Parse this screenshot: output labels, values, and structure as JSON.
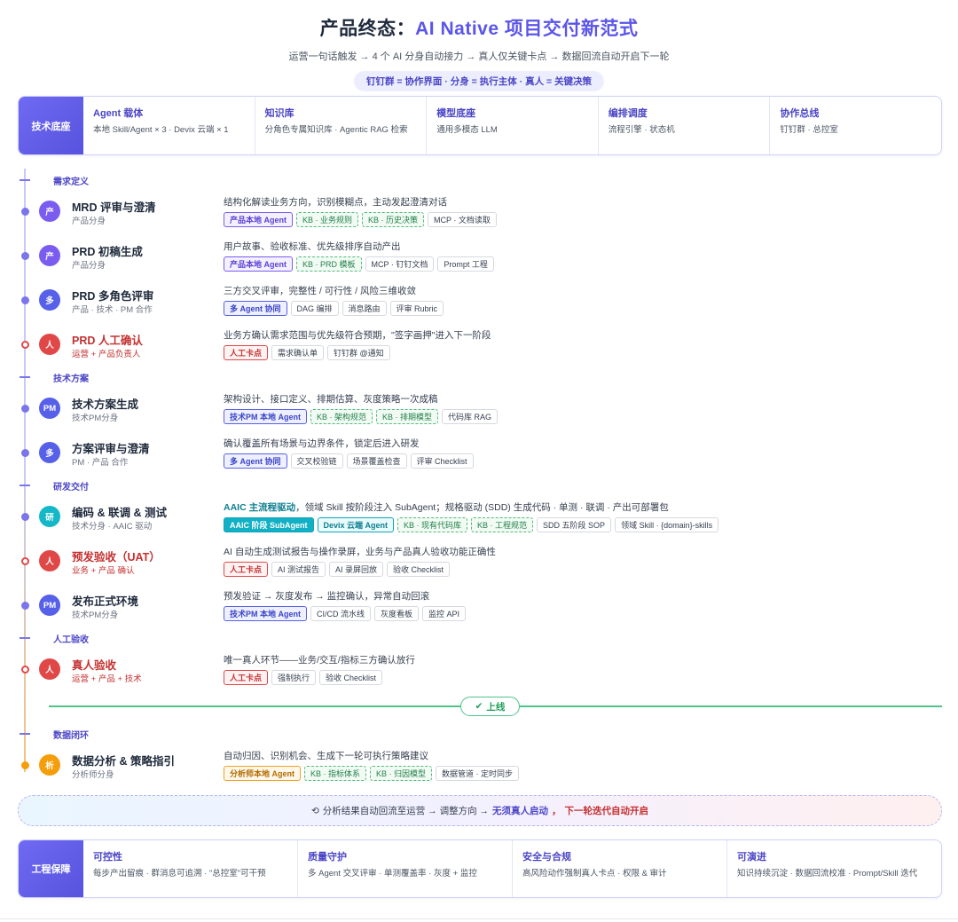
{
  "header": {
    "title_prefix": "产品终态：",
    "title_accent": "AI Native 项目交付新范式",
    "subtitle": "运营一句话触发 → 4 个 AI 分身自动接力 → 真人仅关键卡点 → 数据回流自动开启下一轮",
    "pill": "钉钉群 = 协作界面 · 分身 = 执行主体 · 真人 = 关键决策"
  },
  "tech_base": {
    "label": "技术底座",
    "cells": [
      {
        "title": "Agent 载体",
        "desc": "本地 Skill/Agent × 3 · Devix 云端 × 1"
      },
      {
        "title": "知识库",
        "desc": "分角色专属知识库 · Agentic RAG 检索"
      },
      {
        "title": "模型底座",
        "desc": "通用多模态 LLM"
      },
      {
        "title": "编排调度",
        "desc": "流程引擎 · 状态机"
      },
      {
        "title": "协作总线",
        "desc": "钉钉群 · 总控室"
      }
    ]
  },
  "sections": [
    "需求定义",
    "技术方案",
    "研发交付",
    "人工验收",
    "数据闭环"
  ],
  "steps": [
    {
      "avatar": "产",
      "name": "MRD 评审与澄清",
      "role": "产品分身",
      "desc": "结构化解读业务方向，识别模糊点，主动发起澄清对话",
      "tags": [
        {
          "t": "产品本地 Agent",
          "k": "agent"
        },
        {
          "t": "KB · 业务规则",
          "k": "kb"
        },
        {
          "t": "KB · 历史决策",
          "k": "kb"
        },
        {
          "t": "MCP · 文档读取",
          "k": "plain"
        }
      ]
    },
    {
      "avatar": "产",
      "name": "PRD 初稿生成",
      "role": "产品分身",
      "desc": "用户故事、验收标准、优先级排序自动产出",
      "tags": [
        {
          "t": "产品本地 Agent",
          "k": "agent"
        },
        {
          "t": "KB · PRD 模板",
          "k": "kb"
        },
        {
          "t": "MCP · 钉钉文档",
          "k": "plain"
        },
        {
          "t": "Prompt 工程",
          "k": "plain"
        }
      ]
    },
    {
      "avatar": "多",
      "name": "PRD 多角色评审",
      "role": "产品 · 技术 · PM 合作",
      "desc": "三方交叉评审，完整性 / 可行性 / 风险三维收敛",
      "tags": [
        {
          "t": "多 Agent 协同",
          "k": "multi"
        },
        {
          "t": "DAG 编排",
          "k": "plain"
        },
        {
          "t": "消息路由",
          "k": "plain"
        },
        {
          "t": "评审 Rubric",
          "k": "plain"
        }
      ]
    },
    {
      "avatar": "人",
      "name": "PRD 人工确认",
      "role": "运营 + 产品负责人",
      "desc": "业务方确认需求范围与优先级符合预期，\"签字画押\"进入下一阶段",
      "tags": [
        {
          "t": "人工卡点",
          "k": "human"
        },
        {
          "t": "需求确认单",
          "k": "plain"
        },
        {
          "t": "钉钉群 @通知",
          "k": "plain"
        }
      ]
    },
    {
      "avatar": "PM",
      "name": "技术方案生成",
      "role": "技术PM分身",
      "desc": "架构设计、接口定义、排期估算、灰度策略一次成稿",
      "tags": [
        {
          "t": "技术PM 本地 Agent",
          "k": "multi"
        },
        {
          "t": "KB · 架构规范",
          "k": "kb"
        },
        {
          "t": "KB · 排期模型",
          "k": "kb"
        },
        {
          "t": "代码库 RAG",
          "k": "plain"
        }
      ]
    },
    {
      "avatar": "多",
      "name": "方案评审与澄清",
      "role": "PM · 产品 合作",
      "desc": "确认覆盖所有场景与边界条件，锁定后进入研发",
      "tags": [
        {
          "t": "多 Agent 协同",
          "k": "multi"
        },
        {
          "t": "交叉校验链",
          "k": "plain"
        },
        {
          "t": "场景覆盖检查",
          "k": "plain"
        },
        {
          "t": "评审 Checklist",
          "k": "plain"
        }
      ]
    },
    {
      "avatar": "研",
      "name": "编码 & 联调 & 测试",
      "role": "技术分身 · AAIC 驱动",
      "desc_strong": "AAIC 主流程驱动",
      "desc": "，领域 Skill 按阶段注入 SubAgent；规格驱动 (SDD) 生成代码 · 单测 · 联调 · 产出可部署包",
      "tags": [
        {
          "t": "AAIC 阶段 SubAgent",
          "k": "aaic"
        },
        {
          "t": "Devix 云端 Agent",
          "k": "devix"
        },
        {
          "t": "KB · 现有代码库",
          "k": "kb"
        },
        {
          "t": "KB · 工程规范",
          "k": "kb"
        },
        {
          "t": "SDD 五阶段 SOP",
          "k": "plain"
        },
        {
          "t": "领域 Skill · {domain}-skills",
          "k": "plain"
        }
      ]
    },
    {
      "avatar": "人",
      "name": "预发验收（UAT）",
      "role": "业务 + 产品 确认",
      "desc": "AI 自动生成测试报告与操作录屏，业务与产品真人验收功能正确性",
      "tags": [
        {
          "t": "人工卡点",
          "k": "human"
        },
        {
          "t": "AI 测试报告",
          "k": "plain"
        },
        {
          "t": "AI 录屏回放",
          "k": "plain"
        },
        {
          "t": "验收 Checklist",
          "k": "plain"
        }
      ]
    },
    {
      "avatar": "PM",
      "name": "发布正式环境",
      "role": "技术PM分身",
      "desc": "预发验证 → 灰度发布 → 监控确认，异常自动回滚",
      "tags": [
        {
          "t": "技术PM 本地 Agent",
          "k": "multi"
        },
        {
          "t": "CI/CD 流水线",
          "k": "plain"
        },
        {
          "t": "灰度看板",
          "k": "plain"
        },
        {
          "t": "监控 API",
          "k": "plain"
        }
      ]
    },
    {
      "avatar": "人",
      "name": "真人验收",
      "role": "运营 + 产品 + 技术",
      "desc": "唯一真人环节——业务/交互/指标三方确认放行",
      "tags": [
        {
          "t": "人工卡点",
          "k": "human"
        },
        {
          "t": "强制执行",
          "k": "plain"
        },
        {
          "t": "验收 Checklist",
          "k": "plain"
        }
      ]
    },
    {
      "avatar": "析",
      "name": "数据分析 & 策略指引",
      "role": "分析师分身",
      "desc": "自动归因、识别机会、生成下一轮可执行策略建议",
      "tags": [
        {
          "t": "分析师本地 Agent",
          "k": "analyst"
        },
        {
          "t": "KB · 指标体系",
          "k": "kb"
        },
        {
          "t": "KB · 归因模型",
          "k": "kb"
        },
        {
          "t": "数据管道 · 定时同步",
          "k": "plain"
        }
      ]
    }
  ],
  "launch": {
    "label": "上线",
    "icon": "check-icon"
  },
  "loop": {
    "icon": "cycle-icon",
    "text": "分析结果自动回流至运营 → 调整方向 →",
    "strong1": "无须真人启动",
    "comma": "，",
    "strong2": "下一轮迭代自动开启"
  },
  "guarantee": {
    "label": "工程保障",
    "cells": [
      {
        "title": "可控性",
        "desc": "每步产出留痕 · 群消息可追溯 · \"总控室\"可干预"
      },
      {
        "title": "质量守护",
        "desc": "多 Agent 交叉评审 · 单测覆盖率 · 灰度 + 监控"
      },
      {
        "title": "安全与合规",
        "desc": "高风险动作强制真人卡点 · 权限 & 审计"
      },
      {
        "title": "可演进",
        "desc": "知识持续沉淀 · 数据回流校准 · Prompt/Skill 迭代"
      }
    ]
  },
  "colors": {
    "accent": "#5b55e8",
    "human": "#e04848",
    "kb": "#52b97a",
    "launch": "#4fc48a",
    "analysis": "#f59e0b",
    "aaic": "#12b0c4"
  }
}
